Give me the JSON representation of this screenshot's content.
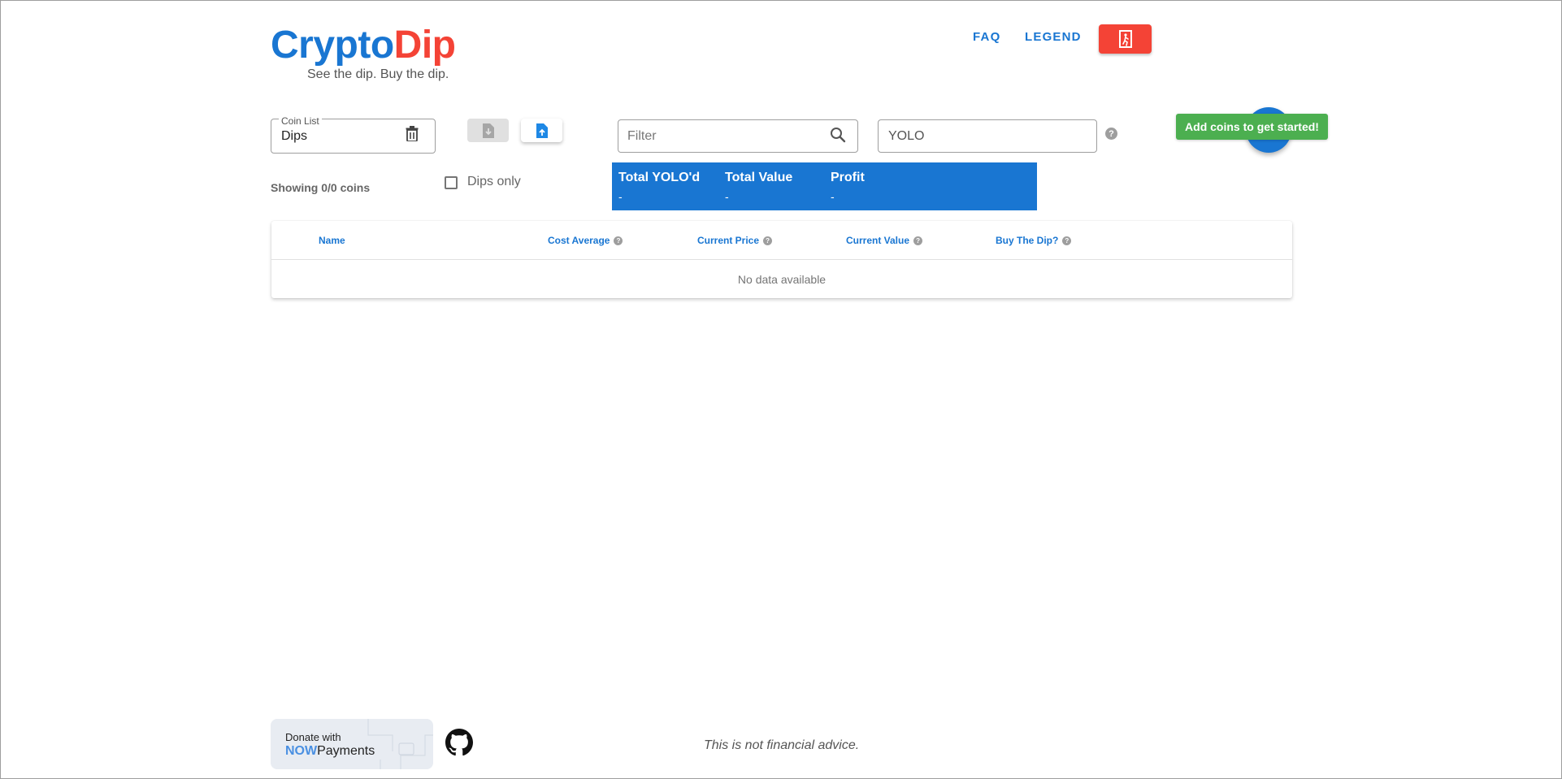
{
  "brand": {
    "part1": "Crypto",
    "part2": "Dip",
    "tagline": "See the dip. Buy the dip."
  },
  "nav": {
    "faq": "FAQ",
    "legend": "LEGEND",
    "exit_icon": "exit-door-icon"
  },
  "coin_list": {
    "label": "Coin List",
    "value": "Dips",
    "delete_icon": "trash-icon"
  },
  "toolbar": {
    "download_icon": "file-download-icon",
    "upload_icon": "file-upload-icon"
  },
  "filter": {
    "placeholder": "Filter",
    "icon": "search-icon"
  },
  "yolo": {
    "value": "YOLO",
    "help": "?"
  },
  "add_coins_tooltip": "Add coins to get started!",
  "showing": "Showing 0/0 coins",
  "dips_only": "Dips only",
  "totals": [
    {
      "title": "Total YOLO'd",
      "value": "-"
    },
    {
      "title": "Total Value",
      "value": "-"
    },
    {
      "title": "Profit",
      "value": "-"
    }
  ],
  "table": {
    "columns": [
      "Name",
      "Cost Average",
      "Current Price",
      "Current Value",
      "Buy The Dip?"
    ],
    "help": "?",
    "empty_text": "No data available"
  },
  "footer": {
    "donate_line1": "Donate with",
    "donate_now": "NOW",
    "donate_payments": "Payments",
    "disclaimer": "This is not financial advice."
  },
  "colors": {
    "primary": "#1976d2",
    "accent_red": "#f44336",
    "success": "#4caf50"
  }
}
